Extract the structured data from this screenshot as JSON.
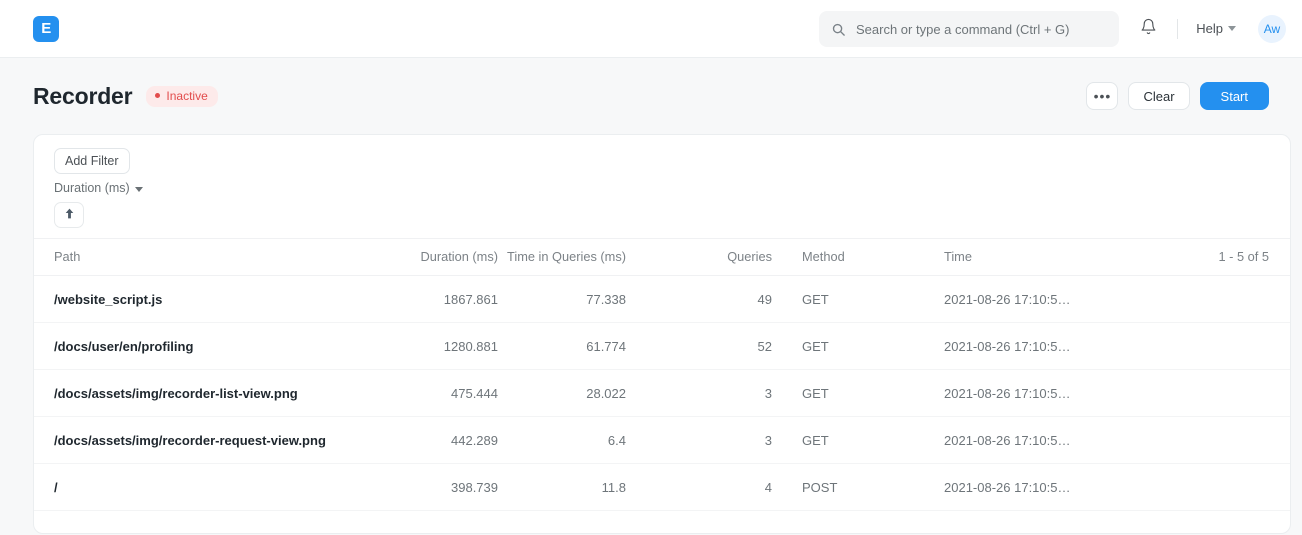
{
  "navbar": {
    "logo_text": "E",
    "search": {
      "placeholder": "Search or type a command (Ctrl + G)",
      "value": ""
    },
    "notifications_icon": "bell-icon",
    "help_label": "Help",
    "avatar_initials": "Aw"
  },
  "header": {
    "title": "Recorder",
    "status": "Inactive",
    "more_label": "•••",
    "clear_label": "Clear",
    "start_label": "Start"
  },
  "filters": {
    "add_filter_label": "Add Filter",
    "sort_field_label": "Duration (ms)",
    "sort_direction_icon": "arrow-up-icon"
  },
  "table": {
    "columns": [
      "Path",
      "Duration (ms)",
      "Time in Queries (ms)",
      "Queries",
      "Method",
      "Time"
    ],
    "count_label": "1 - 5 of 5",
    "rows": [
      {
        "path": "/website_script.js",
        "duration": "1867.861",
        "time_in_queries": "77.338",
        "queries": "49",
        "method": "GET",
        "time": "2021-08-26 17:10:5…"
      },
      {
        "path": "/docs/user/en/profiling",
        "duration": "1280.881",
        "time_in_queries": "61.774",
        "queries": "52",
        "method": "GET",
        "time": "2021-08-26 17:10:5…"
      },
      {
        "path": "/docs/assets/img/recorder-list-view.png",
        "duration": "475.444",
        "time_in_queries": "28.022",
        "queries": "3",
        "method": "GET",
        "time": "2021-08-26 17:10:5…"
      },
      {
        "path": "/docs/assets/img/recorder-request-view.png",
        "duration": "442.289",
        "time_in_queries": "6.4",
        "queries": "3",
        "method": "GET",
        "time": "2021-08-26 17:10:5…"
      },
      {
        "path": "/",
        "duration": "398.739",
        "time_in_queries": "11.8",
        "queries": "4",
        "method": "POST",
        "time": "2021-08-26 17:10:5…"
      }
    ]
  },
  "colors": {
    "accent": "#2490ef",
    "status": "#e24c4c",
    "status_bg": "#fdeaea",
    "page_bg": "#f7f8f9"
  }
}
